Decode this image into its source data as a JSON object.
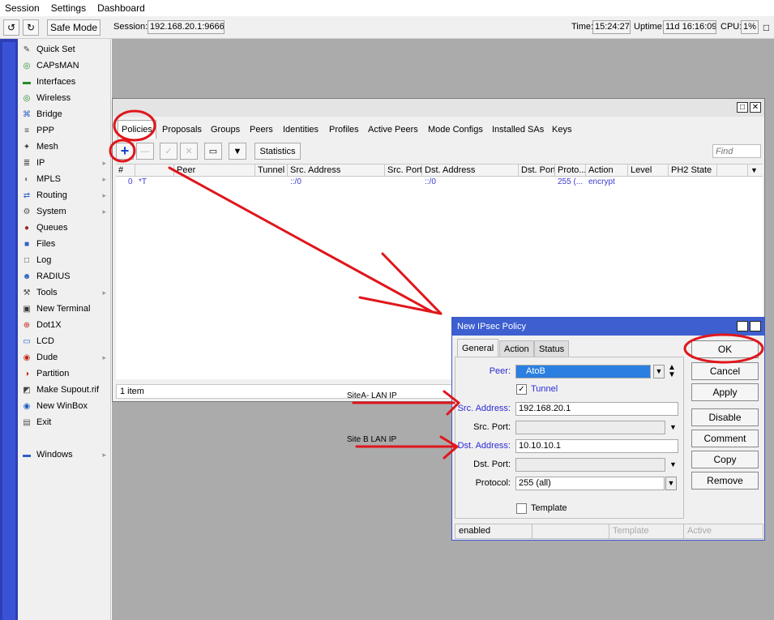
{
  "menu": [
    "Session",
    "Settings",
    "Dashboard"
  ],
  "toolbar": {
    "safe_mode": "Safe Mode",
    "session_label": "Session:",
    "session_value": "192.168.20.1:9666",
    "time_label": "Time:",
    "time_value": "15:24:27",
    "uptime_label": "Uptime:",
    "uptime_value": "11d 16:16:09",
    "cpu_label": "CPU:",
    "cpu_value": "1%"
  },
  "sidebar": {
    "items": [
      {
        "label": "Quick Set",
        "icon": "quick-set-icon",
        "sub": false
      },
      {
        "label": "CAPsMAN",
        "icon": "capsman-icon",
        "sub": false
      },
      {
        "label": "Interfaces",
        "icon": "interfaces-icon",
        "sub": false
      },
      {
        "label": "Wireless",
        "icon": "wireless-icon",
        "sub": false
      },
      {
        "label": "Bridge",
        "icon": "bridge-icon",
        "sub": false
      },
      {
        "label": "PPP",
        "icon": "ppp-icon",
        "sub": false
      },
      {
        "label": "Mesh",
        "icon": "mesh-icon",
        "sub": false
      },
      {
        "label": "IP",
        "icon": "ip-icon",
        "sub": true
      },
      {
        "label": "MPLS",
        "icon": "mpls-icon",
        "sub": true
      },
      {
        "label": "Routing",
        "icon": "routing-icon",
        "sub": true
      },
      {
        "label": "System",
        "icon": "system-icon",
        "sub": true
      },
      {
        "label": "Queues",
        "icon": "queues-icon",
        "sub": false
      },
      {
        "label": "Files",
        "icon": "files-icon",
        "sub": false
      },
      {
        "label": "Log",
        "icon": "log-icon",
        "sub": false
      },
      {
        "label": "RADIUS",
        "icon": "radius-icon",
        "sub": false
      },
      {
        "label": "Tools",
        "icon": "tools-icon",
        "sub": true
      },
      {
        "label": "New Terminal",
        "icon": "terminal-icon",
        "sub": false
      },
      {
        "label": "Dot1X",
        "icon": "dot1x-icon",
        "sub": false
      },
      {
        "label": "LCD",
        "icon": "lcd-icon",
        "sub": false
      },
      {
        "label": "Dude",
        "icon": "dude-icon",
        "sub": true
      },
      {
        "label": "Partition",
        "icon": "partition-icon",
        "sub": false
      },
      {
        "label": "Make Supout.rif",
        "icon": "supout-icon",
        "sub": false
      },
      {
        "label": "New WinBox",
        "icon": "winbox-icon",
        "sub": false
      },
      {
        "label": "Exit",
        "icon": "exit-icon",
        "sub": false
      },
      {
        "label": "Windows",
        "icon": "windows-icon",
        "sub": true
      }
    ]
  },
  "ipsec": {
    "tabs": [
      "Policies",
      "Proposals",
      "Groups",
      "Peers",
      "Identities",
      "Profiles",
      "Active Peers",
      "Mode Configs",
      "Installed SAs",
      "Keys"
    ],
    "statistics": "Statistics",
    "find_placeholder": "Find",
    "columns": [
      "#",
      "Peer",
      "Tunnel",
      "Src. Address",
      "Src. Port",
      "Dst. Address",
      "Dst. Port",
      "Proto...",
      "Action",
      "Level",
      "PH2 State"
    ],
    "rows": [
      {
        "num": "0",
        "flag": "*T",
        "peer": "",
        "tunnel": "",
        "src": "::/0",
        "srcport": "",
        "dst": "::/0",
        "dstport": "",
        "proto": "255 (...",
        "action": "encrypt",
        "level": "",
        "ph2": ""
      }
    ],
    "status": "1 item"
  },
  "dialog": {
    "title": "New IPsec Policy",
    "tabs": [
      "General",
      "Action",
      "Status"
    ],
    "peer_label": "Peer:",
    "peer_value": "AtoB",
    "tunnel_label": "Tunnel",
    "tunnel_checked": true,
    "src_label": "Src. Address:",
    "src_value": "192.168.20.1",
    "srcport_label": "Src. Port:",
    "srcport_value": "",
    "dst_label": "Dst. Address:",
    "dst_value": "10.10.10.1",
    "dstport_label": "Dst. Port:",
    "dstport_value": "",
    "protocol_label": "Protocol:",
    "protocol_value": "255 (all)",
    "template_label": "Template",
    "template_checked": false,
    "buttons": [
      "OK",
      "Cancel",
      "Apply",
      "Disable",
      "Comment",
      "Copy",
      "Remove"
    ],
    "status": [
      "enabled",
      "",
      "Template",
      "Active"
    ]
  },
  "annotations": {
    "site_a": "SiteA- LAN IP",
    "site_b": "Site B LAN IP",
    "color": "#e0161b"
  },
  "colors": {
    "sidebar_strip": "#2c3fb8",
    "workspace": "#ababab",
    "dialog_title": "#3d5fd0",
    "link_text": "#2b2bd6"
  }
}
